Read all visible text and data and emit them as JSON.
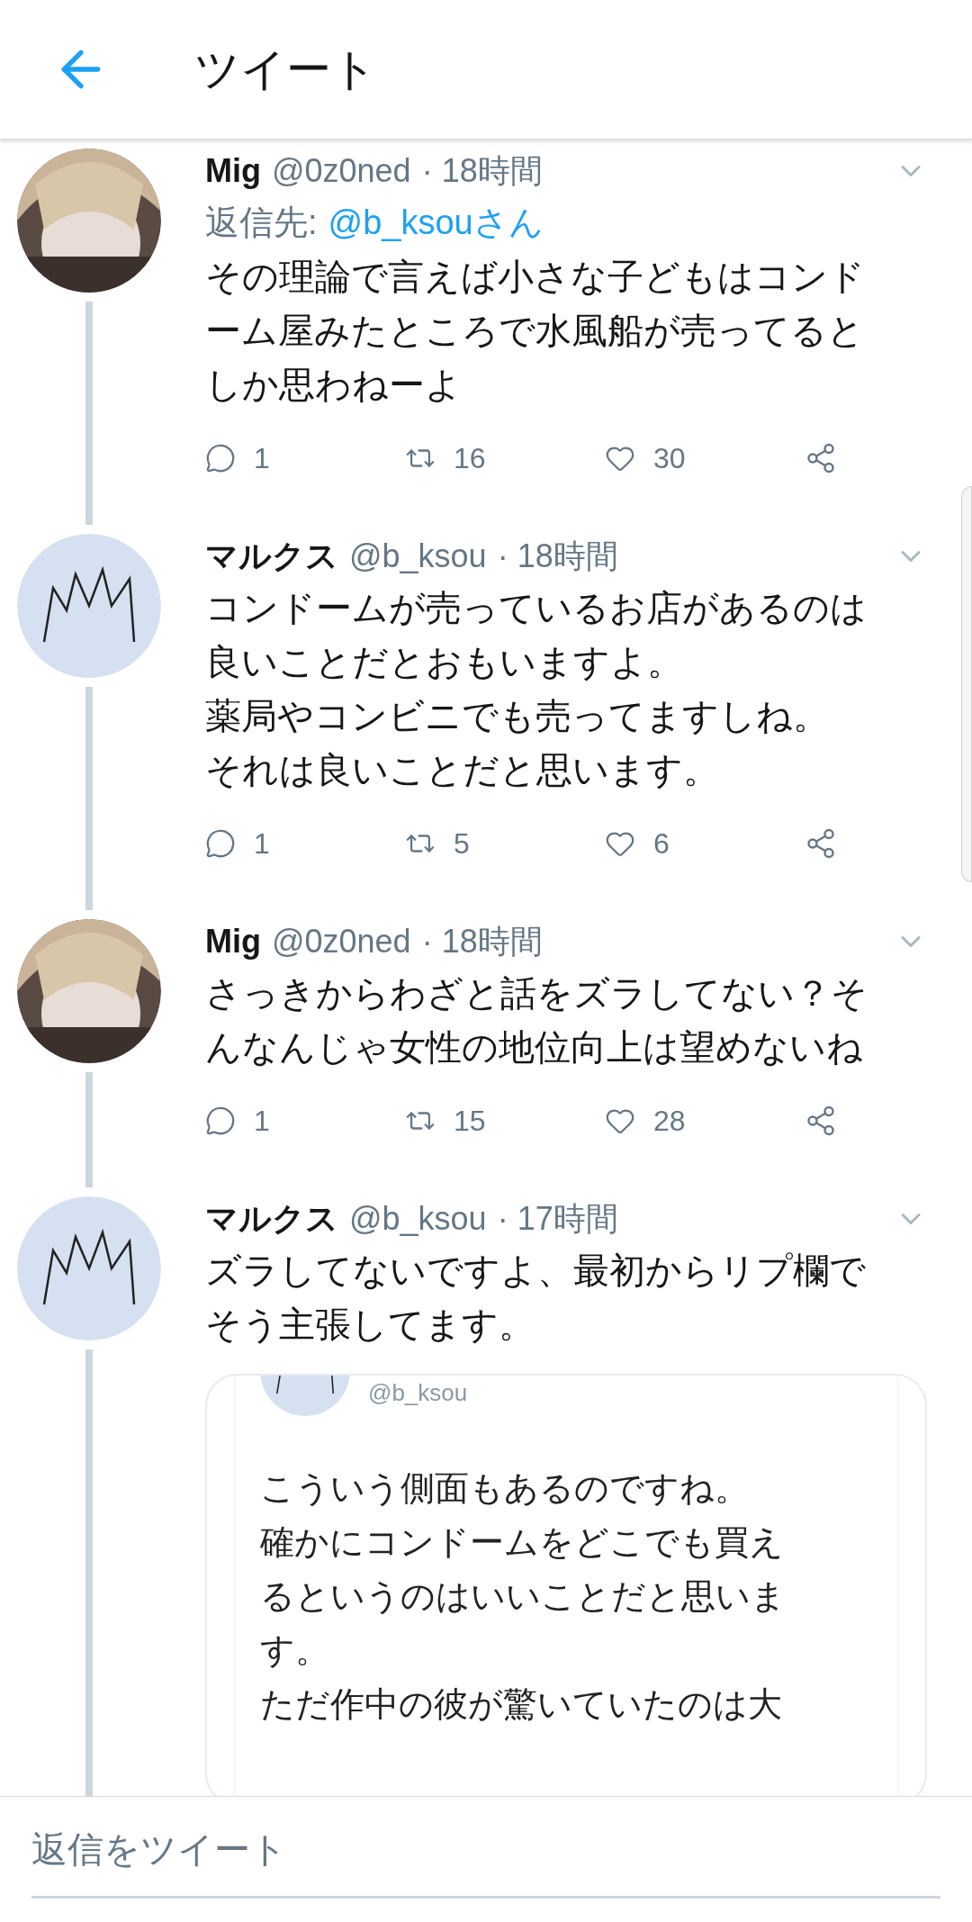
{
  "header": {
    "title": "ツイート"
  },
  "tweets": [
    {
      "name": "Mig",
      "handle": "@0z0ned",
      "time": "· 18時間",
      "reply_to": {
        "label": "返信先:",
        "target": "@b_ksouさん"
      },
      "body": [
        "その理論で言えば小さな子どもはコンドーム屋みたところで水風船が売ってるとしか思わねーよ"
      ],
      "replies": "1",
      "retweets": "16",
      "likes": "30"
    },
    {
      "name": "マルクス",
      "handle": "@b_ksou",
      "time": "· 18時間",
      "body": [
        "コンドームが売っているお店があるのは良いことだとおもいますよ。",
        "薬局やコンビニでも売ってますしね。",
        "それは良いことだと思います。"
      ],
      "replies": "1",
      "retweets": "5",
      "likes": "6"
    },
    {
      "name": "Mig",
      "handle": "@0z0ned",
      "time": "· 18時間",
      "body": [
        "さっきからわざと話をズラしてない？そんなんじゃ女性の地位向上は望めないね"
      ],
      "replies": "1",
      "retweets": "15",
      "likes": "28"
    },
    {
      "name": "マルクス",
      "handle": "@b_ksou",
      "time": "· 17時間",
      "body": [
        "ズラしてないですよ、最初からリプ欄でそう主張してます。"
      ],
      "attached_screenshot": {
        "handle": "@b_ksou",
        "text": [
          "こういう側面もあるのですね。",
          "確かにコンドームをどこでも買えるというのはいいことだと思います。",
          "ただ作中の彼が驚いていたのは大"
        ]
      }
    }
  ],
  "reply_box": {
    "placeholder": "返信をツイート"
  }
}
